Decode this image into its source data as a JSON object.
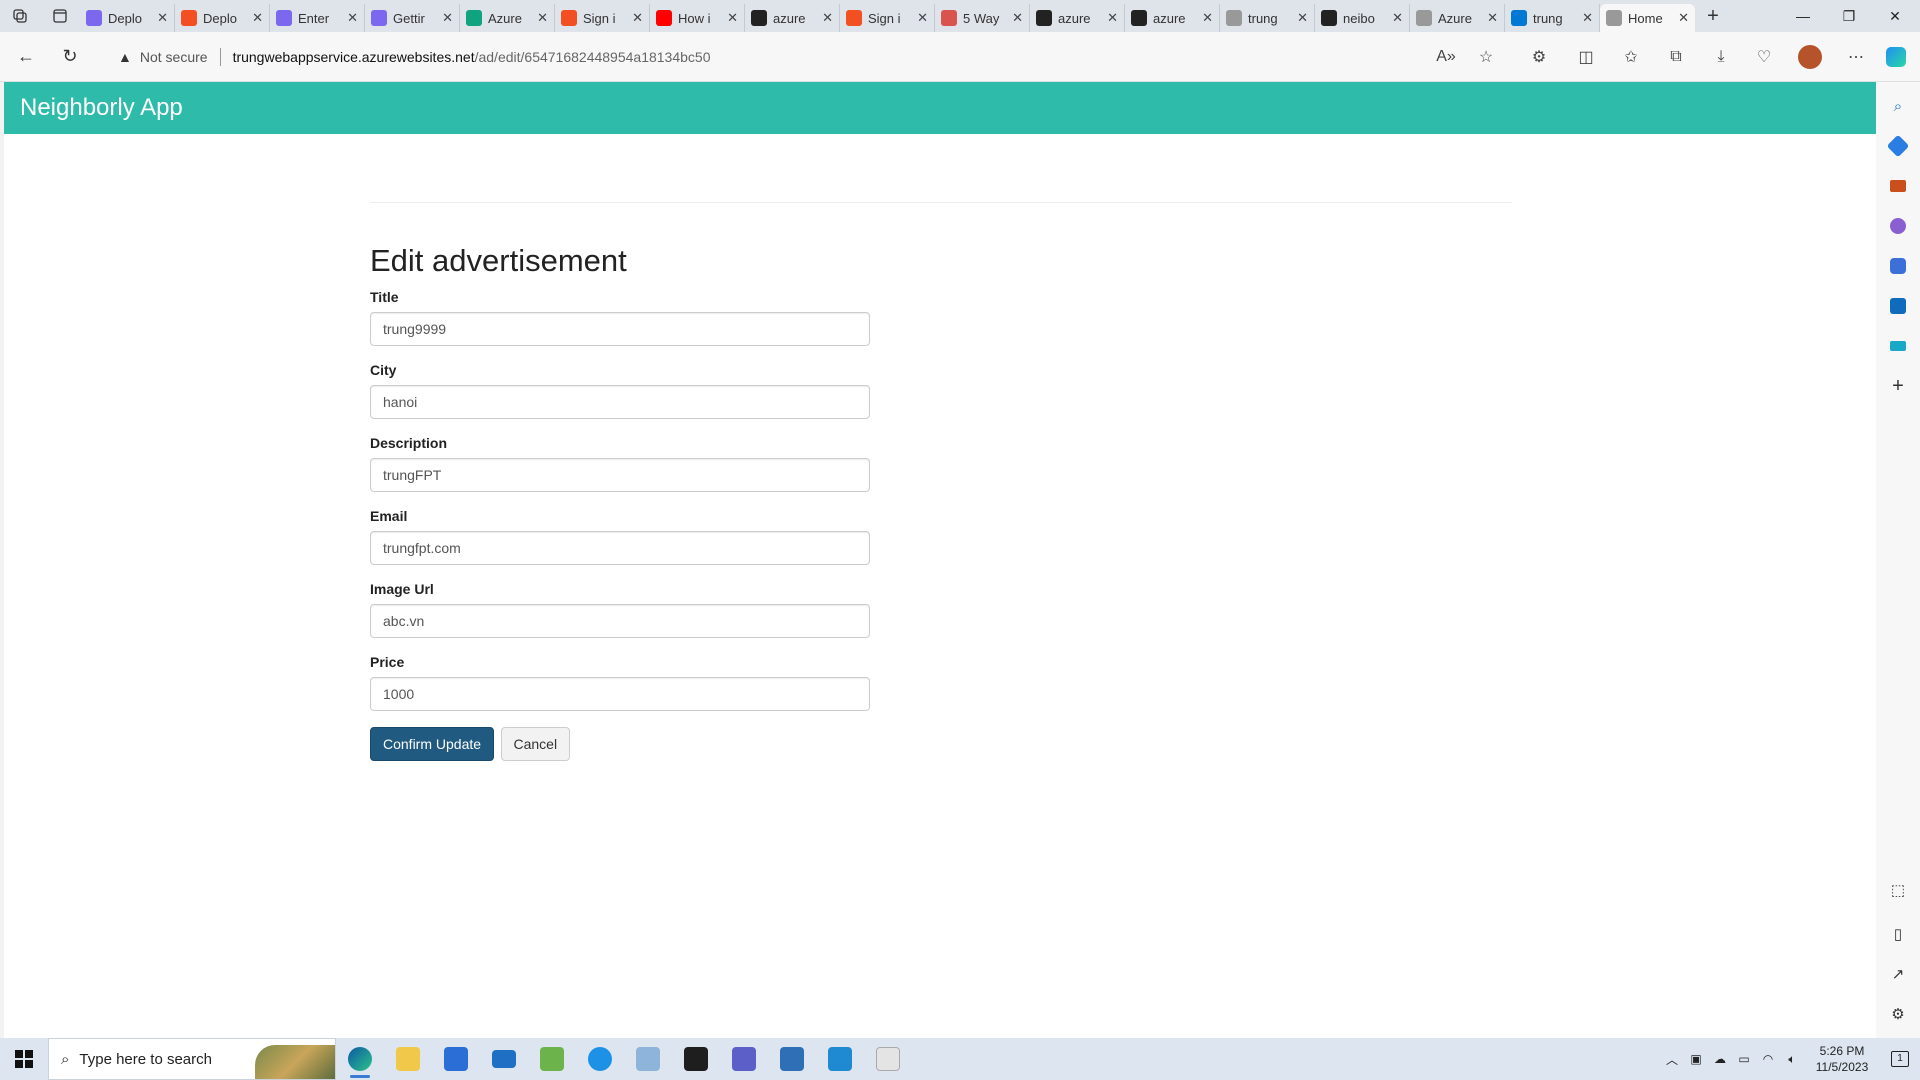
{
  "browser": {
    "tabs": [
      {
        "label": "Deplo",
        "favicon_color": "#7b68ee"
      },
      {
        "label": "Deplo",
        "favicon_color": "#f25022"
      },
      {
        "label": "Enter",
        "favicon_color": "#7b68ee"
      },
      {
        "label": "Gettir",
        "favicon_color": "#7b68ee"
      },
      {
        "label": "Azure",
        "favicon_color": "#10a37f"
      },
      {
        "label": "Sign i",
        "favicon_color": "#f25022"
      },
      {
        "label": "How i",
        "favicon_color": "#ff0000"
      },
      {
        "label": "azure",
        "favicon_color": "#222222"
      },
      {
        "label": "Sign i",
        "favicon_color": "#f25022"
      },
      {
        "label": "5 Way",
        "favicon_color": "#d9534f"
      },
      {
        "label": "azure",
        "favicon_color": "#222222"
      },
      {
        "label": "azure",
        "favicon_color": "#222222"
      },
      {
        "label": "trung",
        "favicon_color": "#999999"
      },
      {
        "label": "neibo",
        "favicon_color": "#222222"
      },
      {
        "label": "Azure",
        "favicon_color": "#999999"
      },
      {
        "label": "trung",
        "favicon_color": "#0078d4"
      },
      {
        "label": "Home",
        "favicon_color": "#999999",
        "active": true
      }
    ],
    "tab_close": "✕",
    "new_tab": "+",
    "address": {
      "security_label": "Not secure",
      "host": "trungwebappservice.azurewebsites.net",
      "path": "/ad/edit/65471682448954a18134bc50"
    }
  },
  "app": {
    "brand": "Neighborly App",
    "brand_color": "#2ebbaa",
    "page_title": "Edit advertisement",
    "fields": [
      {
        "label": "Title",
        "value": "trung9999"
      },
      {
        "label": "City",
        "value": "hanoi"
      },
      {
        "label": "Description",
        "value": "trungFPT"
      },
      {
        "label": "Email",
        "value": "trungfpt.com"
      },
      {
        "label": "Image Url",
        "value": "abc.vn"
      },
      {
        "label": "Price",
        "value": "1000"
      }
    ],
    "confirm_label": "Confirm Update",
    "cancel_label": "Cancel",
    "primary_color": "#215a80"
  },
  "taskbar": {
    "search_placeholder": "Type here to search",
    "time": "5:26 PM",
    "date": "11/5/2023",
    "notification_count": "1"
  }
}
